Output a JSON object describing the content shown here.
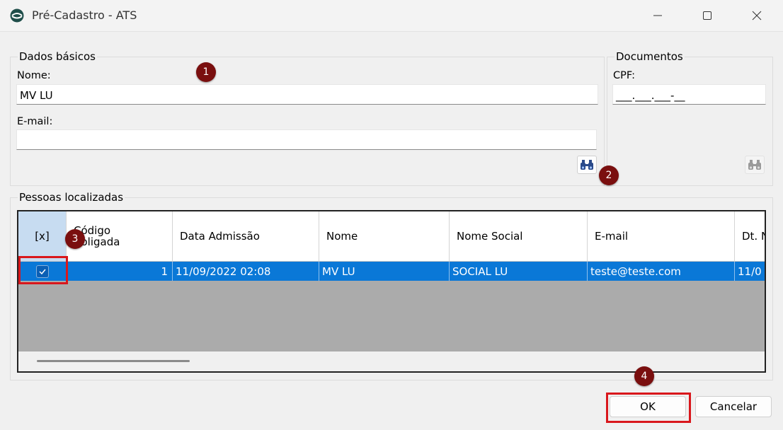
{
  "window": {
    "title": "Pré-Cadastro - ATS",
    "app_icon": "ats-logo-icon",
    "controls": [
      "minimize-icon",
      "maximize-icon",
      "close-icon"
    ]
  },
  "dados_basicos": {
    "legend": "Dados básicos",
    "nome_label": "Nome:",
    "nome_value": "MV LU",
    "email_label": "E-mail:",
    "email_value": "",
    "search_icon": "binoculars-icon"
  },
  "documentos": {
    "legend": "Documentos",
    "cpf_label": "CPF:",
    "cpf_value": "___.___.___-__",
    "search_icon": "binoculars-icon"
  },
  "pessoas": {
    "legend": "Pessoas localizadas",
    "columns": [
      "[x]",
      "Código\nColigada",
      "Data Admissão",
      "Nome",
      "Nome Social",
      "E-mail",
      "Dt. N"
    ],
    "rows": [
      {
        "checked": true,
        "codigo_coligada": "1",
        "data_admissao": "11/09/2022 02:08",
        "nome": "MV LU",
        "nome_social": "SOCIAL LU",
        "email": "teste@teste.com",
        "dt_n": "11/0"
      }
    ]
  },
  "markers": [
    "1",
    "2",
    "3",
    "4"
  ],
  "buttons": {
    "ok": "OK",
    "cancel": "Cancelar"
  },
  "colors": {
    "selection": "#0a78d7",
    "marker": "#7a0f0f",
    "highlight": "#d9171c"
  }
}
